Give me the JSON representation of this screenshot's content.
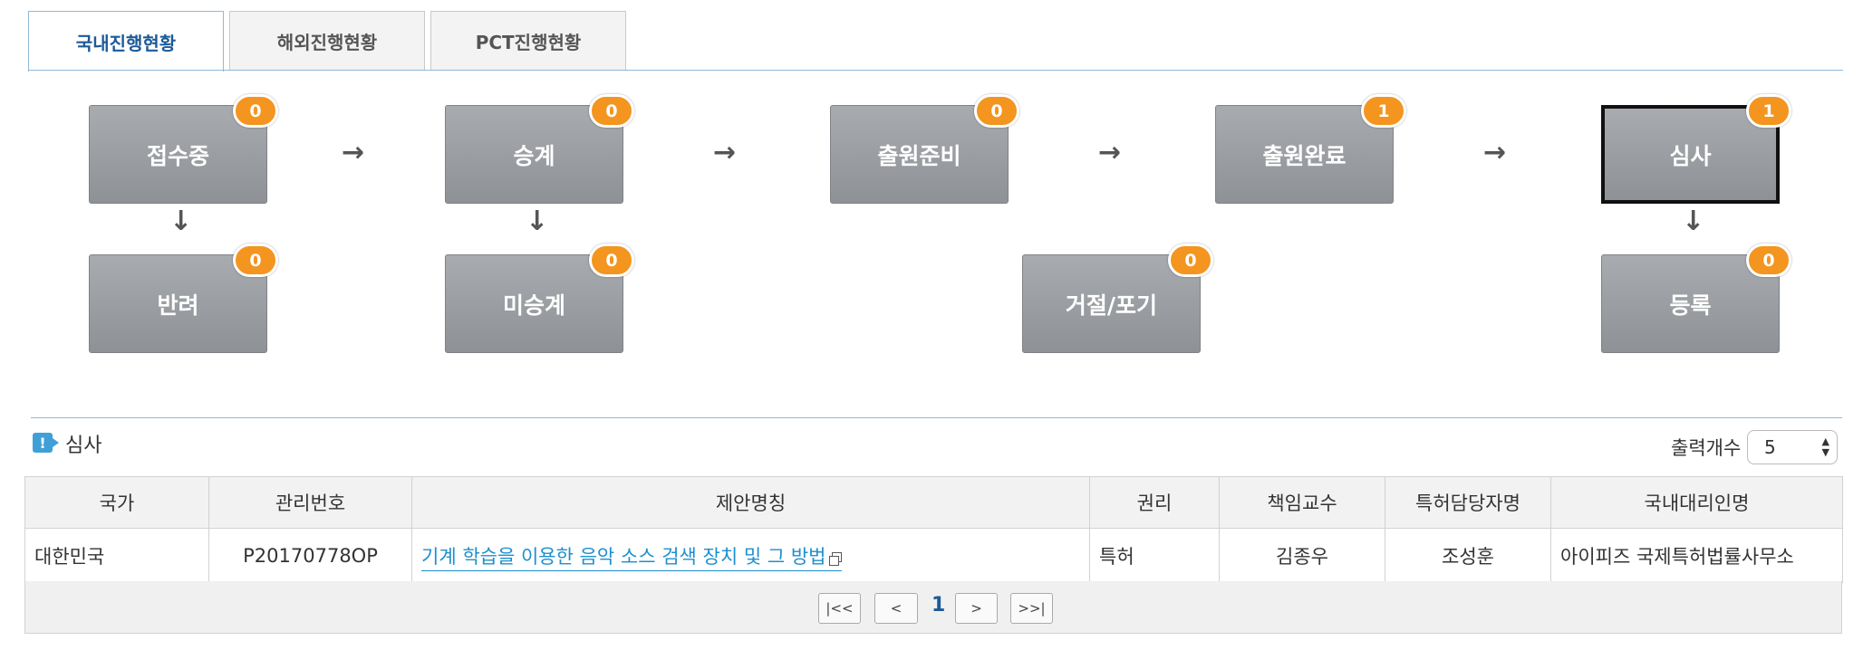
{
  "tabs": [
    {
      "label": "국내진행현황"
    },
    {
      "label": "해외진행현황"
    },
    {
      "label": "PCT진행현황"
    }
  ],
  "flow": {
    "steps": [
      {
        "label": "접수중",
        "count": "0"
      },
      {
        "label": "승계",
        "count": "0"
      },
      {
        "label": "출원준비",
        "count": "0"
      },
      {
        "label": "출원완료",
        "count": "1"
      },
      {
        "label": "심사",
        "count": "1"
      },
      {
        "label": "반려",
        "count": "0"
      },
      {
        "label": "미승계",
        "count": "0"
      },
      {
        "label": "거절/포기",
        "count": "0"
      },
      {
        "label": "등록",
        "count": "0"
      }
    ],
    "arrow_right": "→",
    "arrow_down": "↓",
    "selected_step": "심사"
  },
  "section": {
    "icon": "alert-icon",
    "icon_glyph": "!",
    "title": "심사",
    "count_label": "출력개수",
    "count_value": "5"
  },
  "table": {
    "headers": [
      "국가",
      "관리번호",
      "제안명칭",
      "권리",
      "책임교수",
      "특허담당자명",
      "국내대리인명"
    ],
    "rows": [
      [
        "대한민국",
        "P20170778OP",
        "기계 학습을 이용한 음악 소스 검색 장치 및 그 방법",
        "특허",
        "김종우",
        "조성훈",
        "아이피즈 국제특허법률사무소"
      ]
    ]
  },
  "pagination": {
    "first": "|<<",
    "prev": "<",
    "current": "1",
    "next": ">",
    "last": ">>|"
  },
  "colors": {
    "badge": "#f3951f",
    "box": "#9a9da1",
    "accent_line": "#8fbad8",
    "link": "#1d8fcf",
    "active_tab_text": "#1c5a99"
  }
}
